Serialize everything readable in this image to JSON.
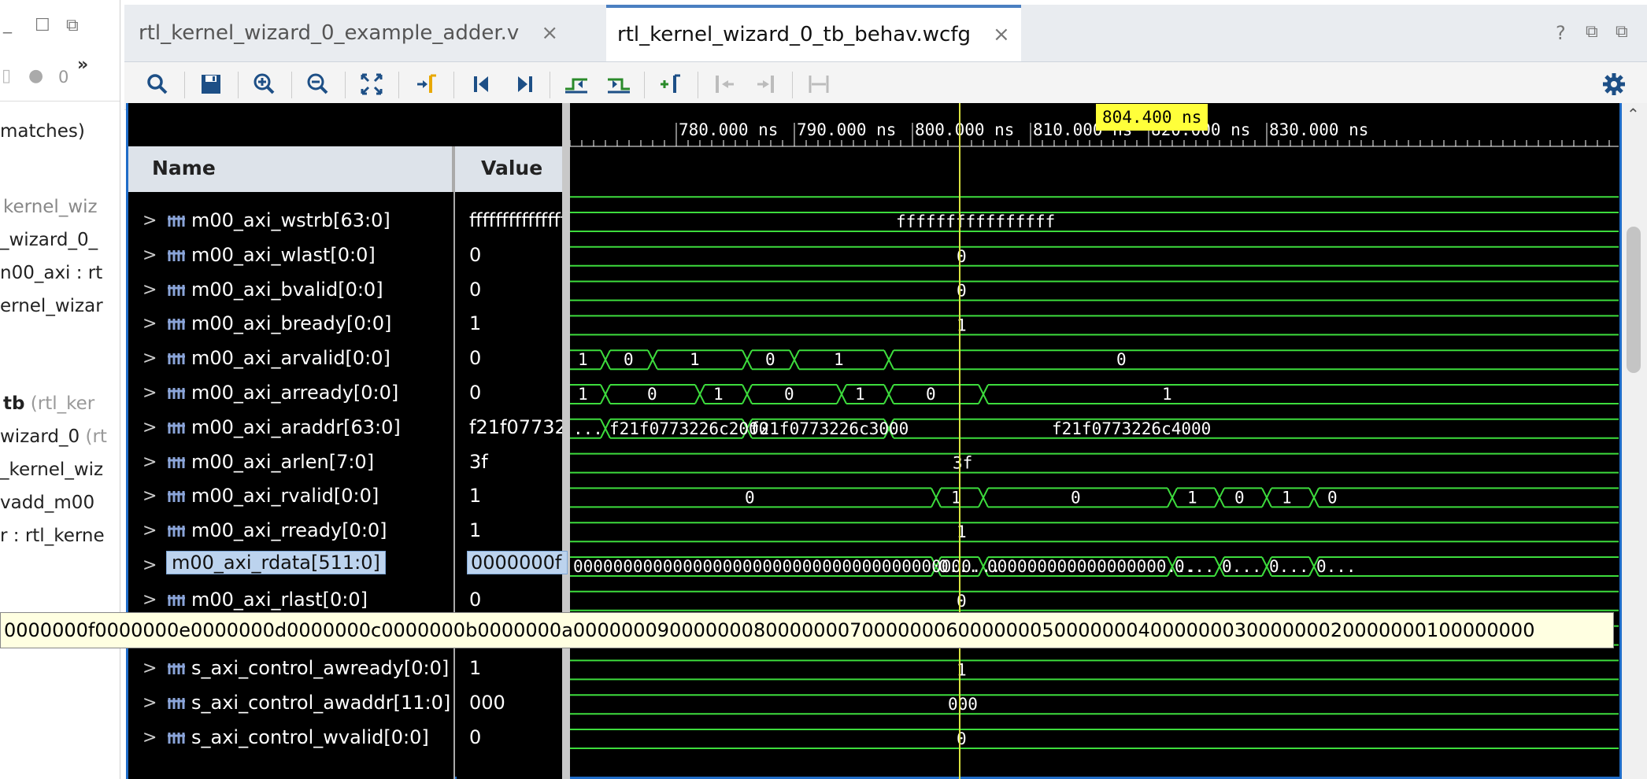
{
  "left_panel": {
    "lines": [
      {
        "text": "matches)",
        "gray": false
      },
      {
        "text": "kernel_wiz",
        "gray": true
      },
      {
        "text": "_wizard_0_",
        "gray": false
      },
      {
        "text": "n00_axi : rt",
        "gray": false
      },
      {
        "text": "ernel_wizar",
        "gray": false
      },
      {
        "text": "tb",
        "gray": false,
        "bold": true,
        "suffix": " (rtl_ker"
      },
      {
        "text": "wizard_0",
        "gray": false,
        "suffix": " (rt"
      },
      {
        "text": "_kernel_wiz",
        "gray": false
      },
      {
        "text": "vadd_m00",
        "gray": false
      },
      {
        "text": "r : rtl_kerne",
        "gray": false
      }
    ],
    "status_count": "0"
  },
  "tabs": [
    {
      "label": "rtl_kernel_wizard_0_example_adder.v",
      "close": "×",
      "active": false
    },
    {
      "label": "rtl_kernel_wizard_0_tb_behav.wcfg",
      "close": "×",
      "active": true
    }
  ],
  "window_controls": {
    "help": "?",
    "restore": "⧉",
    "maximize": "⬜"
  },
  "toolbar": {
    "buttons": [
      "search-icon",
      "save-icon",
      "zoom-in-icon",
      "zoom-out-icon",
      "zoom-fit-icon",
      "go-to-cursor-icon",
      "go-to-start-icon",
      "go-to-end-icon",
      "previous-transition-icon",
      "next-transition-icon",
      "add-marker-icon",
      "previous-marker-icon",
      "next-marker-icon",
      "swap-cursors-icon"
    ],
    "settings_icon": "gear-icon"
  },
  "columns": {
    "name": "Name",
    "value": "Value"
  },
  "cursor": {
    "time_label": "804.400 ns"
  },
  "timeline": {
    "ticks": [
      "780.000 ns",
      "790.000 ns",
      "800.000 ns",
      "810.000 ns",
      "820.000 ns",
      "830.000 ns"
    ]
  },
  "signals": [
    {
      "name": "m00_axi_wstrb[63:0]",
      "value": "ffffffffffffffff"
    },
    {
      "name": "m00_axi_wlast[0:0]",
      "value": "0"
    },
    {
      "name": "m00_axi_bvalid[0:0]",
      "value": "0"
    },
    {
      "name": "m00_axi_bready[0:0]",
      "value": "1"
    },
    {
      "name": "m00_axi_arvalid[0:0]",
      "value": "0"
    },
    {
      "name": "m00_axi_arready[0:0]",
      "value": "0"
    },
    {
      "name": "m00_axi_araddr[63:0]",
      "value": "f21f0773226c4000"
    },
    {
      "name": "m00_axi_arlen[7:0]",
      "value": "3f"
    },
    {
      "name": "m00_axi_rvalid[0:0]",
      "value": "1"
    },
    {
      "name": "m00_axi_rready[0:0]",
      "value": "1"
    },
    {
      "name": "m00_axi_rdata[511:0]",
      "value": "0000000f"
    },
    {
      "name": "m00_axi_rlast[0:0]",
      "value": "0"
    },
    {
      "name": "",
      "value": ""
    },
    {
      "name": "s_axi_control_awready[0:0]",
      "value": "1"
    },
    {
      "name": "s_axi_control_awaddr[11:0]",
      "value": "000"
    },
    {
      "name": "s_axi_control_wvalid[0:0]",
      "value": "0"
    }
  ],
  "waves": {
    "row0_label": "ffffffffffffffff",
    "row1_label": "0",
    "row2_label": "0",
    "row3_label": "1",
    "arvalid_labels": [
      "1",
      "0",
      "1",
      "0",
      "1",
      "0"
    ],
    "arready_labels": [
      "1",
      "0",
      "1",
      "0",
      "1",
      "0",
      "1"
    ],
    "araddr_labels": [
      "...",
      "f21f0773226c2000",
      "f21f0773226c3000",
      "f21f0773226c4000"
    ],
    "arlen_label": "3f",
    "rvalid_labels": [
      "0",
      "1",
      "0",
      "1",
      "0",
      "1",
      "0"
    ],
    "rready_label": "1",
    "rdata_labels": [
      "0000000000000000000000000000000000000000...",
      "0...",
      "000000000000000000...",
      "0...",
      "0...",
      "0...",
      "0..."
    ],
    "rlast_label": "0",
    "awready_label": "1",
    "awaddr_label": "000",
    "wvalid_label": "0"
  },
  "tooltip": {
    "text": "0000000f0000000e0000000d0000000c0000000b0000000a00000009000000080000000700000006000000050000000400000003000000020000000100000000"
  }
}
